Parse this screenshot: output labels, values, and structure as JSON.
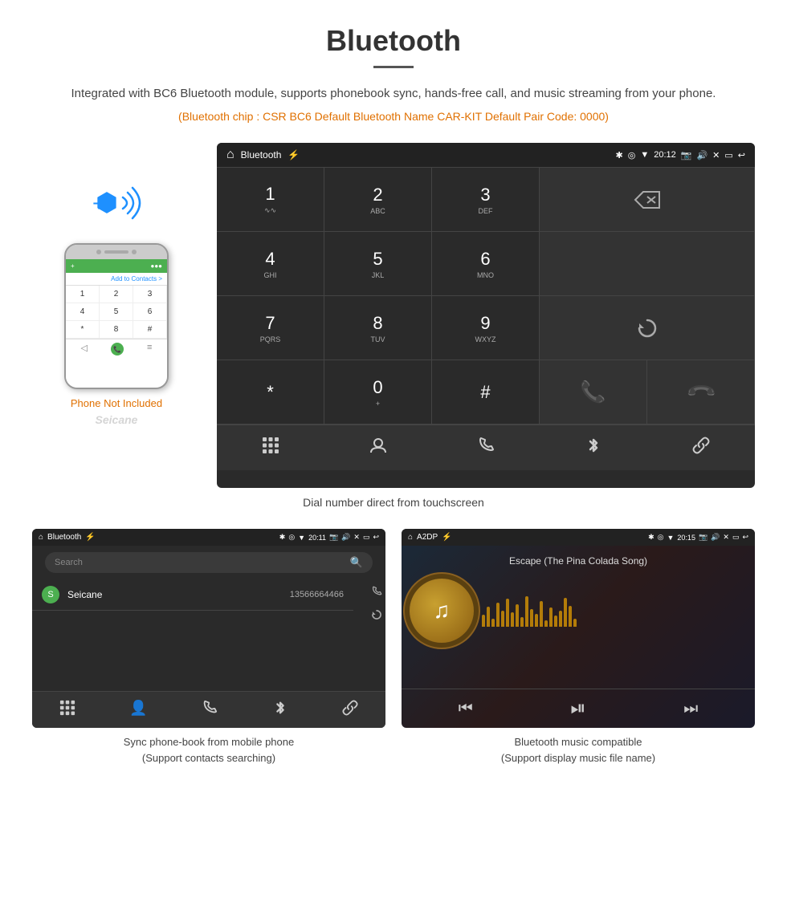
{
  "page": {
    "title": "Bluetooth",
    "description": "Integrated with BC6 Bluetooth module, supports phonebook sync, hands-free call, and music streaming from your phone.",
    "specs": "(Bluetooth chip : CSR BC6    Default Bluetooth Name CAR-KIT    Default Pair Code: 0000)",
    "dial_caption": "Dial number direct from touchscreen",
    "phonebook_caption": "Sync phone-book from mobile phone\n(Support contacts searching)",
    "music_caption": "Bluetooth music compatible\n(Support display music file name)",
    "phone_not_included": "Phone Not Included"
  },
  "dial_screen": {
    "status_bar": {
      "app": "Bluetooth",
      "time": "20:12",
      "usb_icon": "⚡",
      "bt_icon": "✱",
      "location_icon": "◎",
      "signal_icon": "▼"
    },
    "keys": [
      {
        "label": "1",
        "sub": "∿∿",
        "type": "normal"
      },
      {
        "label": "2",
        "sub": "ABC",
        "type": "normal"
      },
      {
        "label": "3",
        "sub": "DEF",
        "type": "normal"
      },
      {
        "label": "⌫",
        "sub": "",
        "type": "backspace",
        "span": 2
      },
      {
        "label": "4",
        "sub": "GHI",
        "type": "normal"
      },
      {
        "label": "5",
        "sub": "JKL",
        "type": "normal"
      },
      {
        "label": "6",
        "sub": "MNO",
        "type": "normal"
      },
      {
        "label": "",
        "sub": "",
        "type": "empty",
        "span": 2
      },
      {
        "label": "7",
        "sub": "PQRS",
        "type": "normal"
      },
      {
        "label": "8",
        "sub": "TUV",
        "type": "normal"
      },
      {
        "label": "9",
        "sub": "WXYZ",
        "type": "normal"
      },
      {
        "label": "↻",
        "sub": "",
        "type": "refresh",
        "span": 2
      },
      {
        "label": "*",
        "sub": "",
        "type": "normal"
      },
      {
        "label": "0",
        "sub": "+",
        "type": "normal"
      },
      {
        "label": "#",
        "sub": "",
        "type": "normal"
      },
      {
        "label": "📞",
        "sub": "",
        "type": "call-green"
      },
      {
        "label": "📞",
        "sub": "",
        "type": "call-red"
      }
    ],
    "bottom_icons": [
      "⊞",
      "👤",
      "📞",
      "✱",
      "⛓"
    ]
  },
  "phonebook_screen": {
    "status_bar": {
      "app": "Bluetooth",
      "time": "20:11"
    },
    "search_placeholder": "Search",
    "contacts": [
      {
        "initial": "S",
        "name": "Seicane",
        "number": "13566664466"
      }
    ],
    "bottom_icons": [
      "⊞",
      "👤",
      "📞",
      "✱",
      "⛓"
    ]
  },
  "music_screen": {
    "status_bar": {
      "app": "A2DP",
      "time": "20:15"
    },
    "song_title": "Escape (The Pina Colada Song)",
    "controls": [
      "⏮",
      "⏯",
      "⏭"
    ]
  }
}
